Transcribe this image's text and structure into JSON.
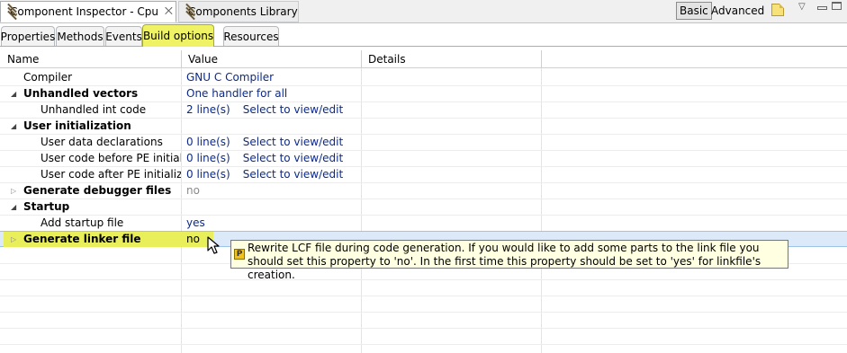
{
  "view_tabs": [
    {
      "label": "Component Inspector - Cpu",
      "close": "⨉",
      "active": true
    },
    {
      "label": "Components Library",
      "active": false
    }
  ],
  "mode": {
    "basic": "Basic",
    "advanced": "Advanced",
    "selected": "Basic"
  },
  "sub_tabs": [
    {
      "label": "Properties",
      "active": false
    },
    {
      "label": "Methods",
      "active": false
    },
    {
      "label": "Events",
      "active": false
    },
    {
      "label": "Build options",
      "active": true
    },
    {
      "label": "Resources",
      "active": false
    }
  ],
  "table": {
    "columns": [
      "Name",
      "Value",
      "Details"
    ],
    "rows": [
      {
        "name": "Compiler",
        "value": "GNU C Compiler",
        "details": "",
        "edit_link": ""
      },
      {
        "name": "Unhandled vectors",
        "value": "One handler for all",
        "details": "",
        "edit_link": ""
      },
      {
        "name": "Unhandled int code",
        "value": "2 line(s)",
        "details": "",
        "edit_link": "Select to view/edit"
      },
      {
        "name": "User initialization",
        "value": "",
        "details": "",
        "edit_link": ""
      },
      {
        "name": "User data declarations",
        "value": "0 line(s)",
        "details": "",
        "edit_link": "Select to view/edit"
      },
      {
        "name": "User code before PE initializat",
        "value": "0 line(s)",
        "details": "",
        "edit_link": "Select to view/edit"
      },
      {
        "name": "User code after PE initializatio",
        "value": "0 line(s)",
        "details": "",
        "edit_link": "Select to view/edit"
      },
      {
        "name": "Generate debugger files",
        "value": "no",
        "details": "",
        "edit_link": ""
      },
      {
        "name": "Startup",
        "value": "",
        "details": "",
        "edit_link": ""
      },
      {
        "name": "Add startup file",
        "value": "yes",
        "details": "",
        "edit_link": ""
      },
      {
        "name": "Generate linker file",
        "value": "no",
        "details": "",
        "edit_link": ""
      }
    ]
  },
  "tooltip": {
    "badge": "P",
    "text": "Rewrite LCF file during code generation. If you would like to add some parts to the link file you should set this property to 'no'. In the first time this property should be set to 'yes' for linkfile's creation."
  }
}
